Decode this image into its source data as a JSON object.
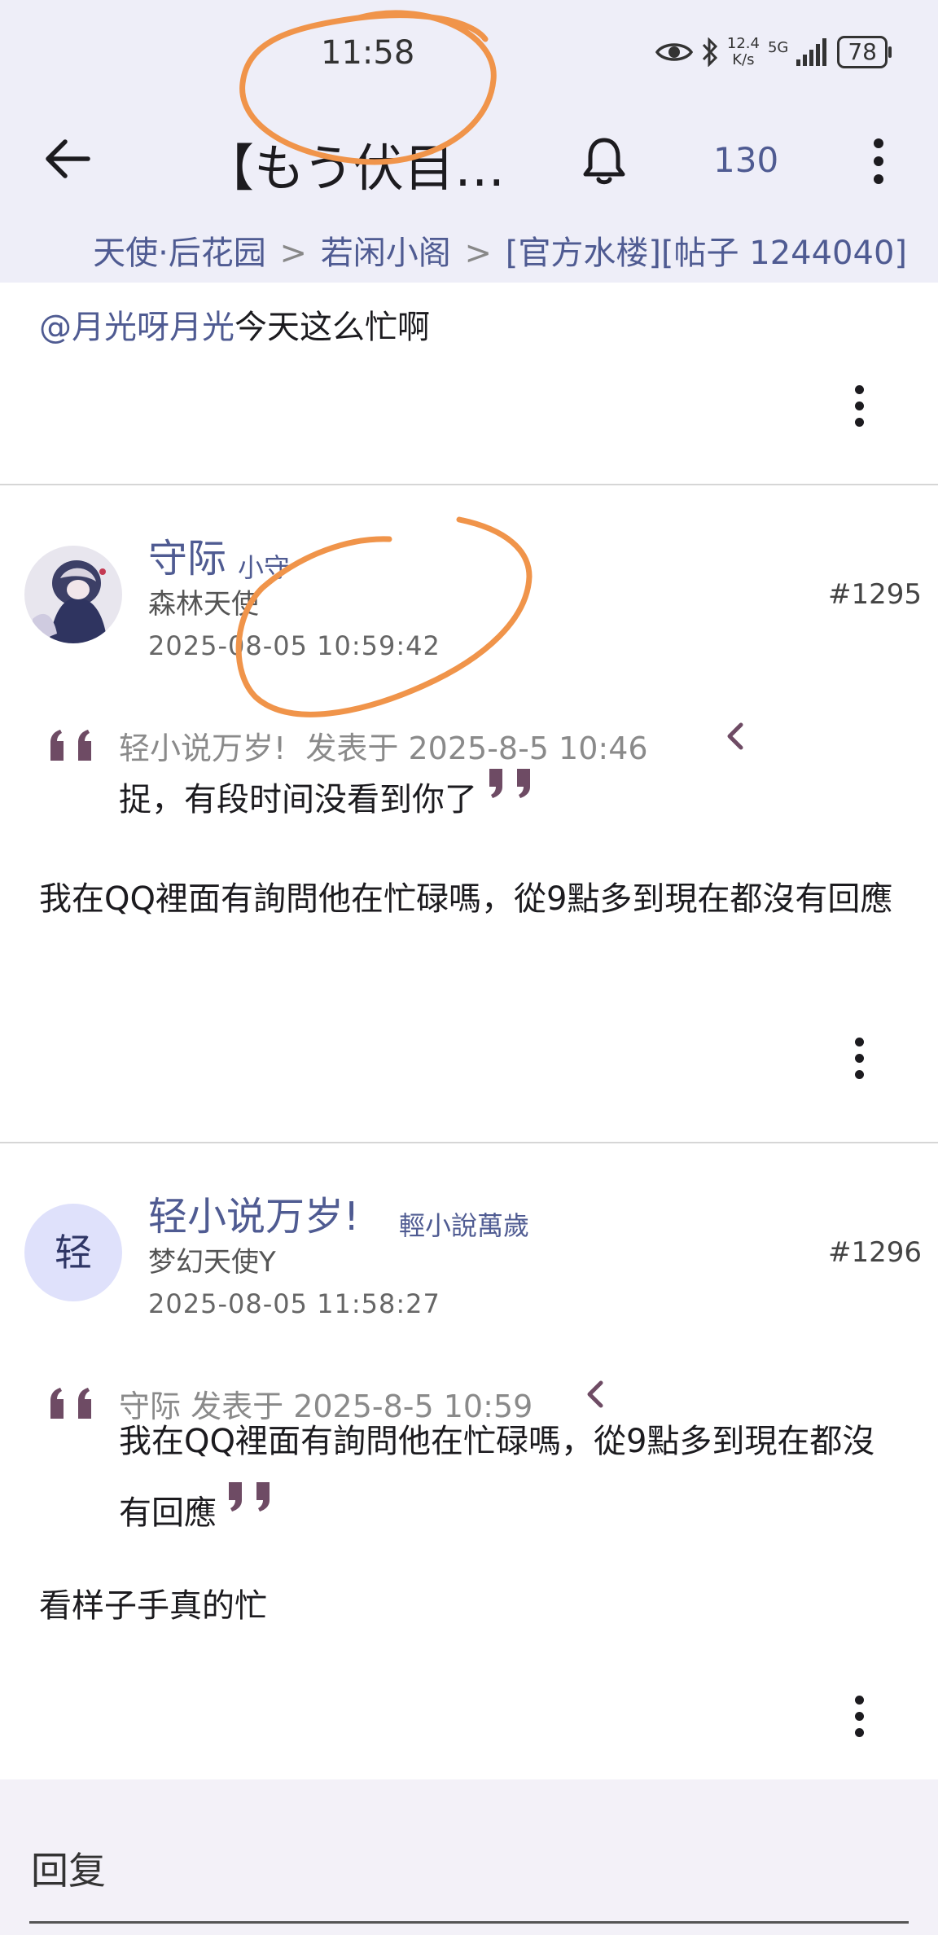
{
  "status_bar": {
    "time": "11:58",
    "net_speed_value": "12.4",
    "net_speed_unit": "K/s",
    "network": "5G",
    "battery": "78"
  },
  "app_bar": {
    "title": "【もう伏目…",
    "notification_count": "130"
  },
  "breadcrumb": {
    "items": [
      "天使·后花园",
      "若闲小阁",
      "[官方水楼][帖子 1244040]"
    ],
    "separator": ">"
  },
  "post_fragment": {
    "mention": "@月光呀月光",
    "text": "今天这么忙啊"
  },
  "posts": [
    {
      "username": "守际",
      "user_title": "小守",
      "user_group": "森林天使",
      "timestamp": "2025-08-05 10:59:42",
      "floor": "#1295",
      "quote": {
        "author": "轻小说万岁!",
        "meta": "发表于 2025-8-5 10:46",
        "text": "捉，有段时间没看到你了"
      },
      "body": "我在QQ裡面有詢問他在忙碌嗎，從9點多到現在都沒有回應"
    },
    {
      "avatar_letter": "轻",
      "username": "轻小说万岁!",
      "user_title": "輕小說萬歲",
      "user_group": "梦幻天使Y",
      "timestamp": "2025-08-05 11:58:27",
      "floor": "#1296",
      "quote": {
        "author": "守际",
        "meta": "发表于 2025-8-5 10:59",
        "text": "我在QQ裡面有詢問他在忙碌嗎，從9點多到現在都沒有回應"
      },
      "body": "看样子手真的忙"
    }
  ],
  "reply": {
    "placeholder": "回复"
  },
  "colors": {
    "accent": "#4f5b92",
    "quote_mark": "#6e4b64",
    "annotation": "#f0944a",
    "top_bar": "#eeeef8"
  }
}
